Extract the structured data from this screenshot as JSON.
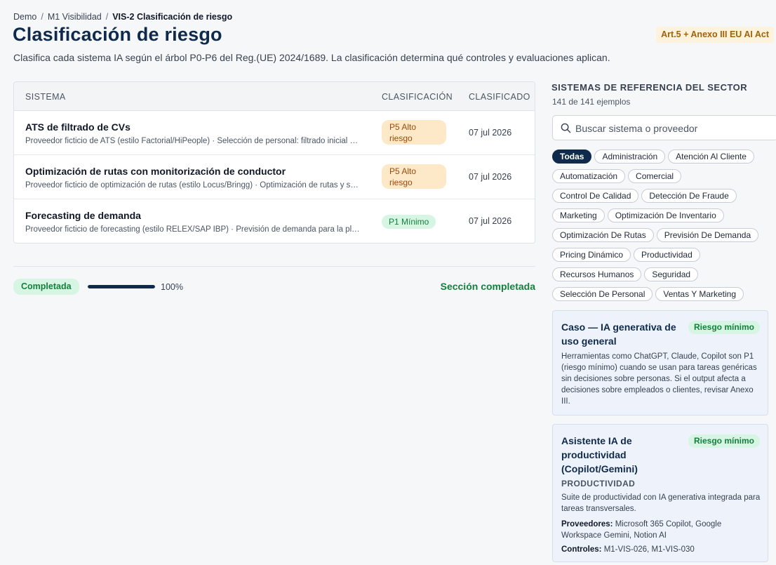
{
  "breadcrumb": {
    "items": [
      "Demo",
      "M1 Visibilidad"
    ],
    "current": "VIS-2 Clasificación de riesgo"
  },
  "header": {
    "title": "Clasificación de riesgo",
    "badge": "Art.5 + Anexo III EU AI Act",
    "subtitle": "Clasifica cada sistema IA según el árbol P0-P6 del Reg.(UE) 2024/1689. La clasificación determina qué controles y evaluaciones aplican."
  },
  "table": {
    "columns": [
      "SISTEMA",
      "CLASIFICACIÓN",
      "CLASIFICADO"
    ],
    "rows": [
      {
        "name": "ATS de filtrado de CVs",
        "desc": "Proveedor ficticio de ATS (estilo Factorial/HiPeople) · Selección de personal: filtrado inicial de candidatos",
        "classification": "P5 Alto riesgo",
        "level": "high",
        "date": "07 jul 2026"
      },
      {
        "name": "Optimización de rutas con monitorización de conductor",
        "desc": "Proveedor ficticio de optimización de rutas (estilo Locus/Bringg) · Optimización de rutas y seguimiento",
        "classification": "P5 Alto riesgo",
        "level": "high",
        "date": "07 jul 2026"
      },
      {
        "name": "Forecasting de demanda",
        "desc": "Proveedor ficticio de forecasting (estilo RELEX/SAP IBP) · Previsión de demanda para la planificación",
        "classification": "P1 Mínimo",
        "level": "low",
        "date": "07 jul 2026"
      }
    ]
  },
  "progress": {
    "status": "Completada",
    "percent": 100,
    "percent_label": "100%",
    "section_label": "Sección completada"
  },
  "sidebar": {
    "title": "SISTEMAS DE REFERENCIA DEL SECTOR",
    "count": "141 de 141 ejemplos",
    "search_placeholder": "Buscar sistema o proveedor",
    "chip_rows": [
      [
        "Todas",
        "Administración",
        "Atención Al Cliente"
      ],
      [
        "Automatización",
        "Comercial"
      ],
      [
        "Control De Calidad",
        "Detección De Fraude"
      ],
      [
        "Marketing",
        "Optimización De Inventario"
      ],
      [
        "Optimización De Rutas",
        "Previsión De Demanda"
      ],
      [
        "Pricing Dinámico",
        "Productividad"
      ],
      [
        "Recursos Humanos",
        "Seguridad"
      ],
      [
        "Selección De Personal",
        "Ventas Y Marketing"
      ]
    ],
    "active_chip": "Todas",
    "cards": [
      {
        "title": "Caso — IA generativa de uso general",
        "badge": "Riesgo mínimo",
        "body": "Herramientas como ChatGPT, Claude, Copilot son P1 (riesgo mínimo) cuando se usan para tareas genéricas sin decisiones sobre personas. Si el output afecta a decisiones sobre empleados o clientes, revisar Anexo III."
      },
      {
        "title": "Asistente IA de productividad (Copilot/Gemini)",
        "badge": "Riesgo mínimo",
        "category": "PRODUCTIVIDAD",
        "body": "Suite de productividad con IA generativa integrada para tareas transversales.",
        "providers_label": "Proveedores:",
        "providers": "Microsoft 365 Copilot, Google Workspace Gemini, Notion AI",
        "controls_label": "Controles:",
        "controls": "M1-VIS-026, M1-VIS-030"
      }
    ]
  },
  "colors": {
    "primary": "#0f2a4a",
    "success": "#15803d",
    "warning_bg": "#fde9c8",
    "success_bg": "#d6f5e3"
  }
}
